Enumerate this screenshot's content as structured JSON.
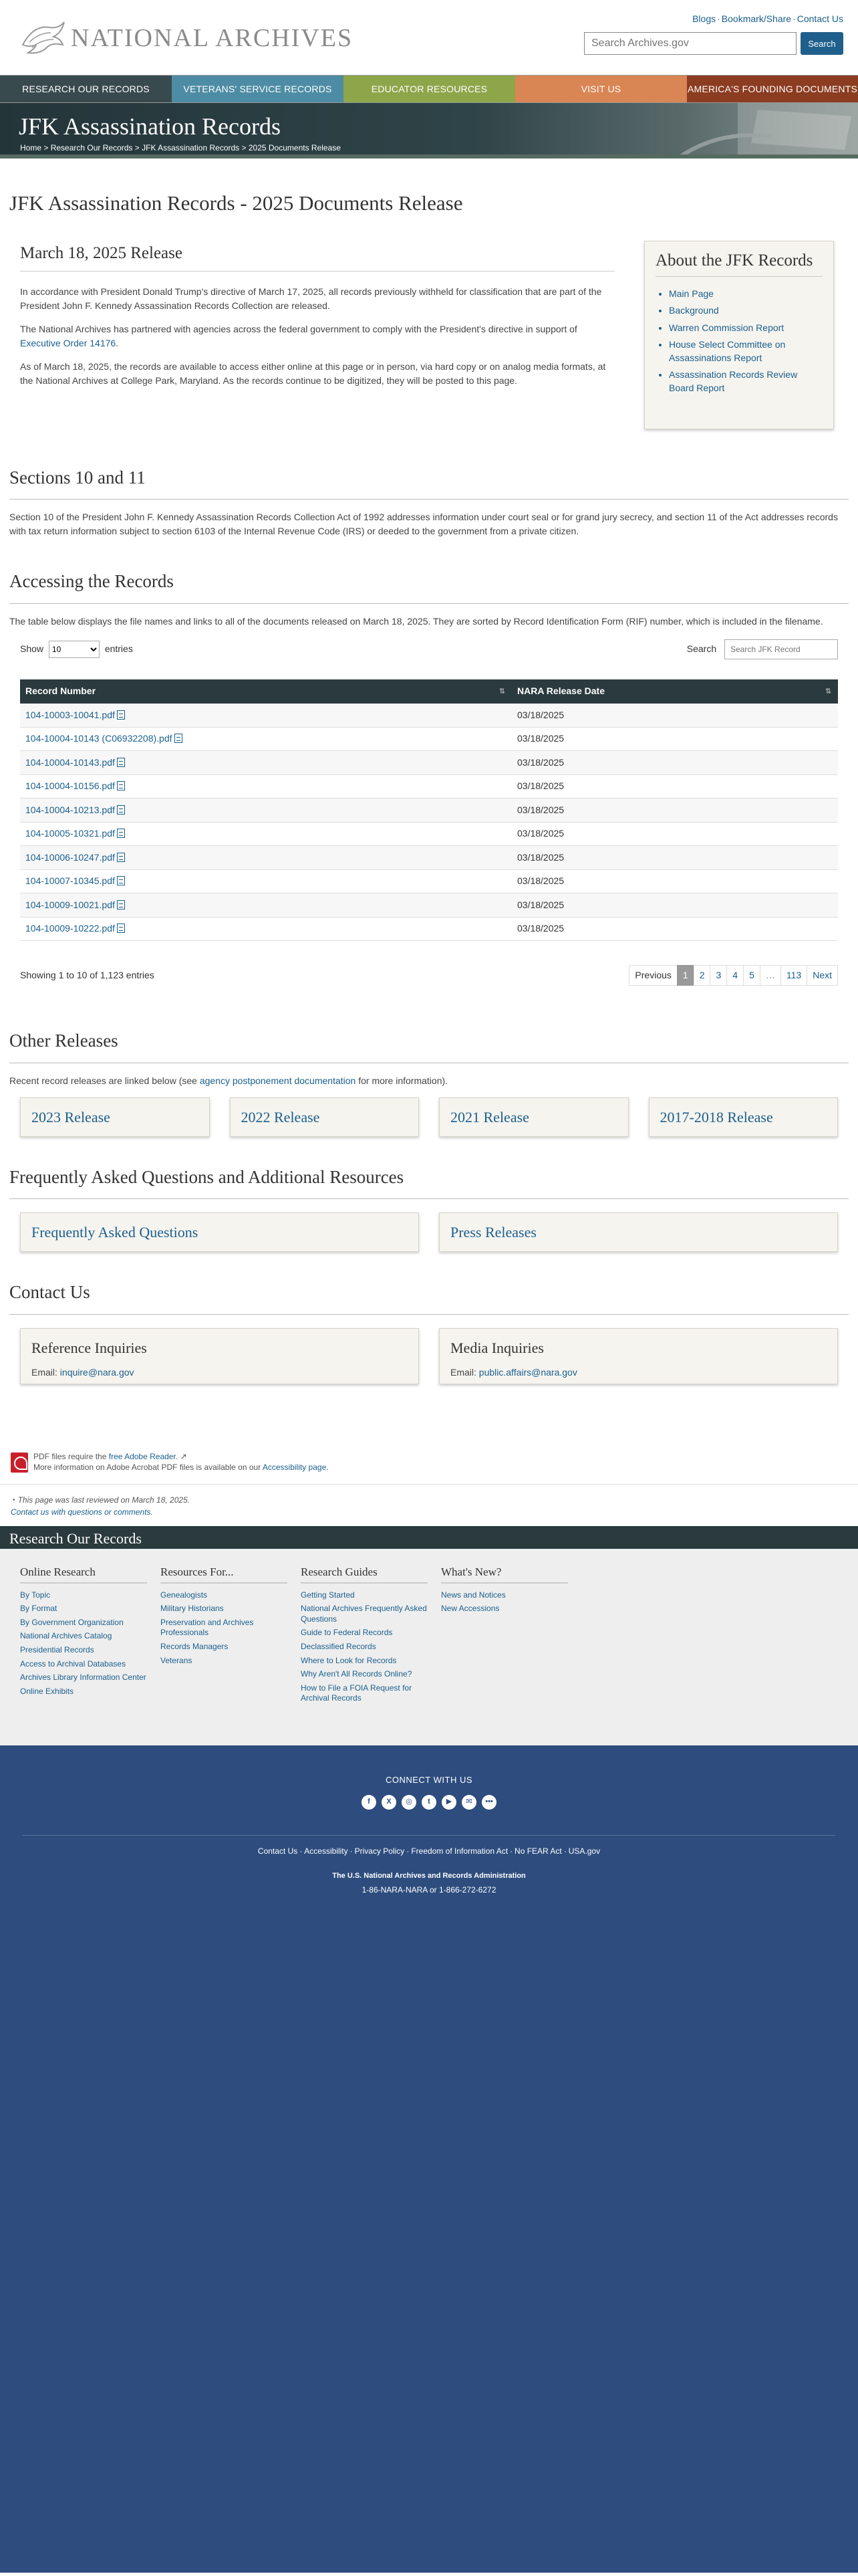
{
  "header": {
    "logo_text": "NATIONAL ARCHIVES",
    "top_links": [
      "Blogs",
      "Bookmark/Share",
      "Contact Us"
    ],
    "search_placeholder": "Search Archives.gov",
    "search_button": "Search"
  },
  "nav": [
    "Research Our Records",
    "Veterans' Service Records",
    "Educator Resources",
    "Visit Us",
    "America's Founding Documents"
  ],
  "banner": {
    "title": "JFK Assassination Records",
    "breadcrumb": [
      "Home",
      "Research Our Records",
      "JFK Assassination Records",
      "2025 Documents Release"
    ]
  },
  "page_title": "JFK Assassination Records - 2025 Documents Release",
  "release": {
    "heading": "March 18, 2025 Release",
    "p1": "In accordance with President Donald Trump's directive of March 17, 2025, all records previously withheld for classification that are part of the President John F. Kennedy Assassination Records Collection are released.",
    "p2_text": "The National Archives has partnered with agencies across the federal government to comply with the President's directive in support of",
    "p2_link": "Executive Order 14176",
    "p3": "As of March 18, 2025, the records are available to access either online at this page or in person, via hard copy or on analog media formats, at the National Archives at College Park, Maryland. As the records continue to be digitized, they will be posted to this page."
  },
  "sidebar": {
    "title": "About the JFK Records",
    "links": [
      "Main Page",
      "Background",
      "Warren Commission Report",
      "House Select Committee on Assassinations Report",
      "Assassination Records Review Board Report"
    ]
  },
  "sections": {
    "heading": "Sections 10 and 11",
    "text": "Section 10 of the President John F. Kennedy Assassination Records Collection Act of 1992 addresses information under court seal or for grand jury secrecy, and section 11 of the Act addresses records with tax return information subject to section 6103 of the Internal Revenue Code (IRS) or deeded to the government from a private citizen."
  },
  "accessing": {
    "heading": "Accessing the Records",
    "text": "The table below displays the file names and links to all of the documents released on March 18, 2025.  They are sorted by Record Identification Form (RIF) number, which is included in the filename.",
    "show_label": "Show",
    "entries_value": "10",
    "entries_label": "entries",
    "search_label": "Search",
    "search_placeholder": "Search JFK Record"
  },
  "table": {
    "headers": [
      "Record Number",
      "NARA Release Date"
    ],
    "rows": [
      {
        "record": "104-10003-10041.pdf",
        "date": "03/18/2025"
      },
      {
        "record": "104-10004-10143 (C06932208).pdf",
        "date": "03/18/2025"
      },
      {
        "record": "104-10004-10143.pdf",
        "date": "03/18/2025"
      },
      {
        "record": "104-10004-10156.pdf",
        "date": "03/18/2025"
      },
      {
        "record": "104-10004-10213.pdf",
        "date": "03/18/2025"
      },
      {
        "record": "104-10005-10321.pdf",
        "date": "03/18/2025"
      },
      {
        "record": "104-10006-10247.pdf",
        "date": "03/18/2025"
      },
      {
        "record": "104-10007-10345.pdf",
        "date": "03/18/2025"
      },
      {
        "record": "104-10009-10021.pdf",
        "date": "03/18/2025"
      },
      {
        "record": "104-10009-10222.pdf",
        "date": "03/18/2025"
      }
    ],
    "info": "Showing 1 to 10 of 1,123 entries",
    "pager": [
      "Previous",
      "1",
      "2",
      "3",
      "4",
      "5",
      "…",
      "113",
      "Next"
    ]
  },
  "other_releases": {
    "heading": "Other Releases",
    "text_before": "Recent record releases are linked below (see",
    "link": "agency postponement documentation",
    "text_after": "for more information).",
    "cards": [
      "2023 Release",
      "2022 Release",
      "2021 Release",
      "2017-2018 Release"
    ]
  },
  "faq": {
    "heading": "Frequently Asked Questions and Additional Resources",
    "cards": [
      "Frequently Asked Questions",
      "Press Releases"
    ]
  },
  "contact": {
    "heading": "Contact Us",
    "reference_title": "Reference Inquiries",
    "reference_label": "Email:",
    "reference_email": "inquire@nara.gov",
    "media_title": "Media Inquiries",
    "media_label": "Email:",
    "media_email": "public.affairs@nara.gov"
  },
  "pdf_note": {
    "line1_text": "PDF files require the",
    "line1_link": "free Adobe Reader.",
    "line2_text": "More information on Adobe Acrobat PDF files is available on our",
    "line2_link": "Accessibility page."
  },
  "reviewed": {
    "text": "This page was last reviewed on March 18, 2025.",
    "contact": "Contact us with questions or comments."
  },
  "footer": {
    "heading": "Research Our Records",
    "columns": [
      {
        "title": "Online Research",
        "links": [
          "By Topic",
          "By Format",
          "By Government Organization",
          "National Archives Catalog",
          "Presidential Records",
          "Access to Archival Databases",
          "Archives Library Information Center",
          "Online Exhibits"
        ]
      },
      {
        "title": "Resources For...",
        "links": [
          "Genealogists",
          "Military Historians",
          "Preservation and Archives Professionals",
          "Records Managers",
          "Veterans"
        ]
      },
      {
        "title": "Research Guides",
        "links": [
          "Getting Started",
          "National Archives Frequently Asked Questions",
          "Guide to Federal Records",
          "Declassified Records",
          "Where to Look for Records",
          "Why Aren't All Records Online?",
          "How to File a FOIA Request for Archival Records"
        ]
      },
      {
        "title": "What's New?",
        "links": [
          "News and Notices",
          "New Accessions"
        ]
      }
    ],
    "connect": "CONNECT WITH US",
    "socials": [
      "facebook-icon",
      "x-icon",
      "instagram-icon",
      "tumblr-icon",
      "youtube-icon",
      "email-icon",
      "more-icon"
    ],
    "legal": [
      "Contact Us",
      "Accessibility",
      "Privacy Policy",
      "Freedom of Information Act",
      "No FEAR Act",
      "USA.gov"
    ],
    "agency": "The U.S. National Archives and Records Administration",
    "phone": "1-86-NARA-NARA or 1-866-272-6272"
  }
}
